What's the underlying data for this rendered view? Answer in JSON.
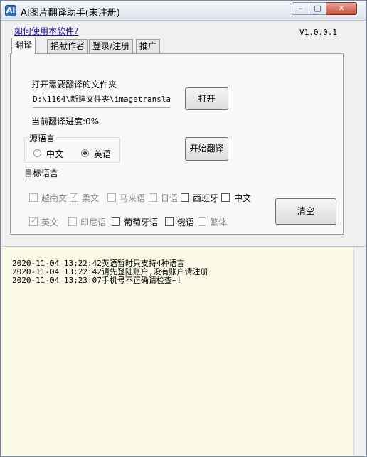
{
  "window": {
    "title": "AI图片翻译助手(未注册)",
    "icon_text": "AI",
    "min_glyph": "–",
    "max_glyph": "□",
    "close_glyph": "✕"
  },
  "header": {
    "help_link": "如何使用本软件?",
    "version": "V1.0.0.1"
  },
  "tabs": [
    {
      "label": "翻译"
    },
    {
      "label": "捐献作者"
    },
    {
      "label": "登录/注册"
    },
    {
      "label": "推广"
    }
  ],
  "translate": {
    "folder_label": "打开需要翻译的文件夹",
    "path_value": "D:\\1104\\新建文件夹\\imagetranslat",
    "open_button": "打开",
    "progress_label": "当前翻译进度:0%",
    "source_lang_title": "源语言",
    "source_langs": [
      {
        "label": "中文",
        "selected": false
      },
      {
        "label": "英语",
        "selected": true
      }
    ],
    "start_button": "开始翻译",
    "target_lang_title": "目标语言",
    "target_langs": [
      {
        "label": "越南文",
        "checked": false,
        "enabled": false
      },
      {
        "label": "柔文",
        "checked": true,
        "enabled": false
      },
      {
        "label": "马来语",
        "checked": false,
        "enabled": false
      },
      {
        "label": "日语",
        "checked": false,
        "enabled": false
      },
      {
        "label": "西班牙",
        "checked": false,
        "enabled": true
      },
      {
        "label": "中文",
        "checked": false,
        "enabled": true
      },
      {
        "label": "英文",
        "checked": true,
        "enabled": false
      },
      {
        "label": "印尼语",
        "checked": false,
        "enabled": false
      },
      {
        "label": "葡萄牙语",
        "checked": false,
        "enabled": true
      },
      {
        "label": "俄语",
        "checked": false,
        "enabled": true
      },
      {
        "label": "繁体",
        "checked": false,
        "enabled": false
      }
    ],
    "clear_button": "清空"
  },
  "log": {
    "lines": [
      "2020-11-04 13:22:42英语暂时只支持4种语言",
      "2020-11-04 13:22:42请先登陆账户,没有账户请注册",
      "2020-11-04 13:23:07手机号不正确请检查~!"
    ]
  }
}
